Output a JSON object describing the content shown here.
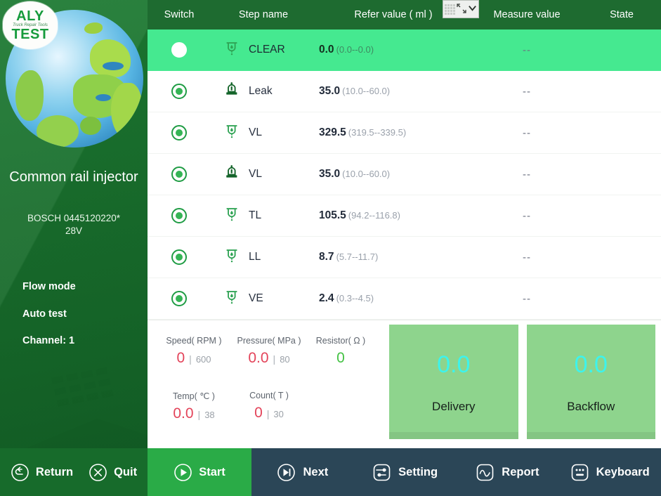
{
  "brand": {
    "logo_line1": "ALY",
    "logo_tagline": "Truck Repair Tools",
    "logo_line2": "TEST",
    "globe_icon": "globe-icon"
  },
  "sidebar": {
    "device_name": "Common rail injector",
    "device_code": "BOSCH  0445120220*\n28V",
    "items": [
      {
        "label": "Flow mode"
      },
      {
        "label": "Auto test"
      },
      {
        "label": "Channel: 1"
      }
    ]
  },
  "table": {
    "headers": {
      "switch": "Switch",
      "step_name": "Step name",
      "refer_value": "Refer value ( ml )",
      "measure_value": "Measure value",
      "state": "State"
    },
    "ime_widget": {
      "grid_icon": "keyboard-grid-icon",
      "expand_icon": "expand-arrows-icon",
      "chevron_icon": "chevron-down-icon",
      "chevron_glyph": "⌄"
    },
    "rows": [
      {
        "step": "CLEAR",
        "icon": "injector-spray-icon",
        "refer": "0.0",
        "range": "(0.0--0.0)",
        "measure": "--",
        "state": "",
        "active": true
      },
      {
        "step": "Leak",
        "icon": "injector-leak-icon",
        "refer": "35.0",
        "range": "(10.0--60.0)",
        "measure": "--",
        "state": "",
        "active": false
      },
      {
        "step": "VL",
        "icon": "injector-spray-icon",
        "refer": "329.5",
        "range": "(319.5--339.5)",
        "measure": "--",
        "state": "",
        "active": false
      },
      {
        "step": "VL",
        "icon": "injector-leak-icon",
        "refer": "35.0",
        "range": "(10.0--60.0)",
        "measure": "--",
        "state": "",
        "active": false
      },
      {
        "step": "TL",
        "icon": "injector-spray-icon",
        "refer": "105.5",
        "range": "(94.2--116.8)",
        "measure": "--",
        "state": "",
        "active": false
      },
      {
        "step": "LL",
        "icon": "injector-spray-icon",
        "refer": "8.7",
        "range": "(5.7--11.7)",
        "measure": "--",
        "state": "",
        "active": false
      },
      {
        "step": "VE",
        "icon": "injector-spray-icon",
        "refer": "2.4",
        "range": "(0.3--4.5)",
        "measure": "--",
        "state": "",
        "active": false
      }
    ]
  },
  "gauges": [
    {
      "title": "Speed( RPM )",
      "value": "0",
      "limit": "600",
      "sep": "|",
      "status": "alert"
    },
    {
      "title": "Pressure( MPa )",
      "value": "0.0",
      "limit": "80",
      "sep": "|",
      "status": "alert"
    },
    {
      "title": "Resistor( Ω )",
      "value": "0",
      "limit": "",
      "sep": "",
      "status": "ok"
    },
    {
      "title": "Temp( ℃ )",
      "value": "0.0",
      "limit": "38",
      "sep": "|",
      "status": "alert"
    },
    {
      "title": "Count( T )",
      "value": "0",
      "limit": "30",
      "sep": "|",
      "status": "alert"
    }
  ],
  "flow_panels": [
    {
      "value": "0.0",
      "label": "Delivery"
    },
    {
      "value": "0.0",
      "label": "Backflow"
    }
  ],
  "bottom_bar": {
    "return": {
      "label": "Return",
      "icon": "undo-arrow-icon"
    },
    "quit": {
      "label": "Quit",
      "icon": "close-circle-icon"
    },
    "start": {
      "label": "Start",
      "icon": "play-circle-icon"
    },
    "next": {
      "label": "Next",
      "icon": "skip-forward-icon"
    },
    "setting": {
      "label": "Setting",
      "icon": "sliders-icon"
    },
    "report": {
      "label": "Report",
      "icon": "waveform-icon"
    },
    "keyboard": {
      "label": "Keyboard",
      "icon": "keyboard-icon"
    }
  },
  "colors": {
    "header_green": "#1e6b30",
    "sidebar_green": "#176b2b",
    "row_highlight": "#45e990",
    "start_green": "#2aab47",
    "navy": "#2b4657",
    "flow_panel_green": "#8ed48d",
    "flow_value_cyan": "#3df3ec",
    "alert_red": "#e3445a",
    "ok_green": "#44c244"
  }
}
